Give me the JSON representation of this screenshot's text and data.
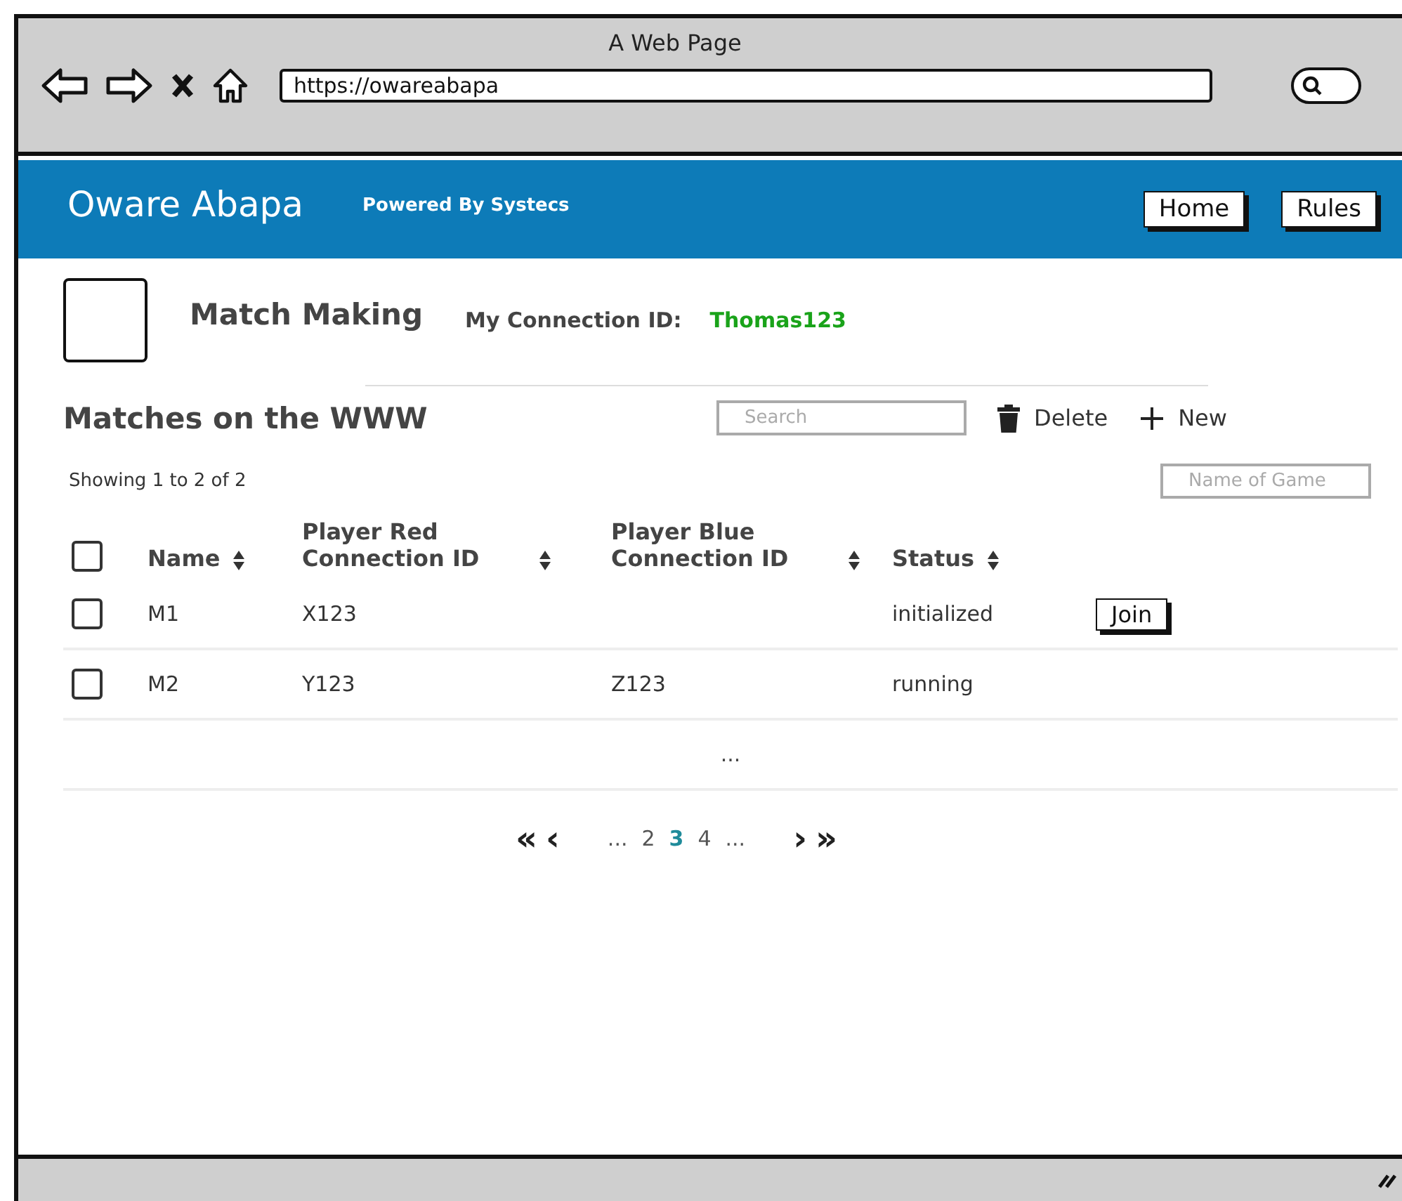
{
  "window": {
    "title": "A Web Page",
    "url": "https://owareabapa"
  },
  "header": {
    "title": "Oware Abapa",
    "subtitle": "Powered By Systecs",
    "buttons": [
      "Home",
      "Rules"
    ]
  },
  "profile": {
    "title": "Match Making",
    "connection_label": "My Connection ID:",
    "connection_id": "Thomas123"
  },
  "matches": {
    "title": "Matches on the WWW",
    "search": {
      "placeholder": "Search"
    },
    "actions": [
      {
        "kind": "delete",
        "label": "Delete"
      },
      {
        "kind": "new",
        "label": "New"
      }
    ],
    "summary": "Showing 1 to 2 of 2",
    "filter": {
      "placeholder": "Name of Game"
    },
    "table": {
      "select_all": {
        "checked": false
      },
      "columns": [
        "Name",
        "Player Red Connection ID",
        "Player Blue Connection ID",
        "Status"
      ],
      "rows": [
        {
          "checked": false,
          "cells": [
            "M1",
            "X123",
            "",
            "initialized"
          ],
          "action": "Join"
        },
        {
          "checked": false,
          "cells": [
            "M2",
            "Y123",
            "Z123",
            "running"
          ]
        }
      ],
      "more": "..."
    },
    "pagination": {
      "first": "«",
      "prev": "‹",
      "pages": [
        {
          "label": "...",
          "selected": false
        },
        {
          "label": "2",
          "selected": false
        },
        {
          "label": "3",
          "selected": true
        },
        {
          "label": "4",
          "selected": false
        },
        {
          "label": "...",
          "selected": false
        }
      ],
      "next": "›",
      "last": "»"
    }
  }
}
